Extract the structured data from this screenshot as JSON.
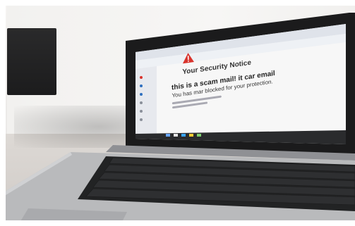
{
  "scene": {
    "notice": {
      "title": "Your Security Notice",
      "headline": "this is a scam mail! it car email",
      "subline": "You has mar blocked for your protection."
    },
    "colors": {
      "warning": "#d9332c",
      "screen": "#f3f3f3",
      "bezel": "#1b1b1c",
      "keyboard": "#222324",
      "palm": "#b9babc",
      "sidebar": "#2e6fbf"
    },
    "icon": "warning-triangle-icon"
  }
}
